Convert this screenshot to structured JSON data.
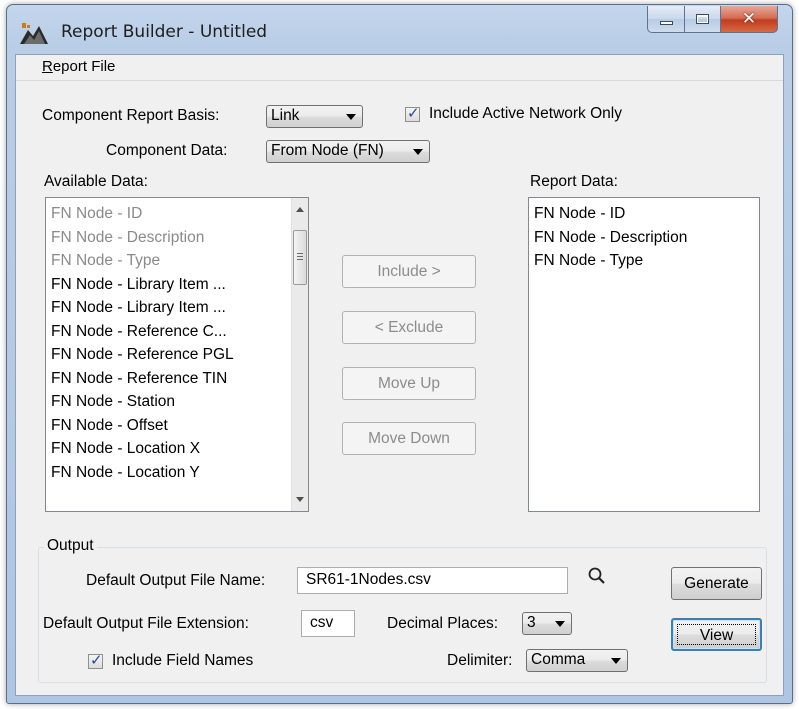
{
  "window": {
    "title": "Report Builder - Untitled"
  },
  "menu": {
    "report_file_first": "R",
    "report_file_rest": "eport File"
  },
  "component": {
    "basis_label": "Component Report Basis:",
    "basis_value": "Link",
    "include_active_label": "Include Active Network Only",
    "include_active_checked": true,
    "data_label": "Component Data:",
    "data_value": "From Node (FN)"
  },
  "available": {
    "label": "Available Data:",
    "items": [
      "FN Node - ID",
      "FN Node - Description",
      "FN Node - Type",
      "FN Node - Library Item ...",
      "FN Node - Library Item ...",
      "FN Node - Reference C...",
      "FN Node - Reference PGL",
      "FN Node - Reference TIN",
      "FN Node - Station",
      "FN Node - Offset",
      "FN Node - Location X",
      "FN Node - Location Y"
    ]
  },
  "report": {
    "label": "Report Data:",
    "items": [
      "FN Node - ID",
      "FN Node - Description",
      "FN Node - Type"
    ]
  },
  "actions": {
    "include": "Include >",
    "exclude": "< Exclude",
    "move_up": "Move Up",
    "move_down": "Move Down"
  },
  "output": {
    "group_label": "Output",
    "file_name_label": "Default Output File Name:",
    "file_name_value": "SR61-1Nodes.csv",
    "generate": "Generate",
    "extension_label": "Default Output File Extension:",
    "extension_value": "csv",
    "decimal_label": "Decimal Places:",
    "decimal_value": "3",
    "view": "View",
    "include_field_names_label": "Include Field Names",
    "include_field_names_checked": true,
    "delimiter_label": "Delimiter:",
    "delimiter_value": "Comma"
  },
  "colors": {
    "title_gradient_top": "#c3d6ec",
    "close_button": "#c13d1f",
    "client_bg": "#f0f0f0",
    "disabled_text": "#8a8a8a"
  }
}
